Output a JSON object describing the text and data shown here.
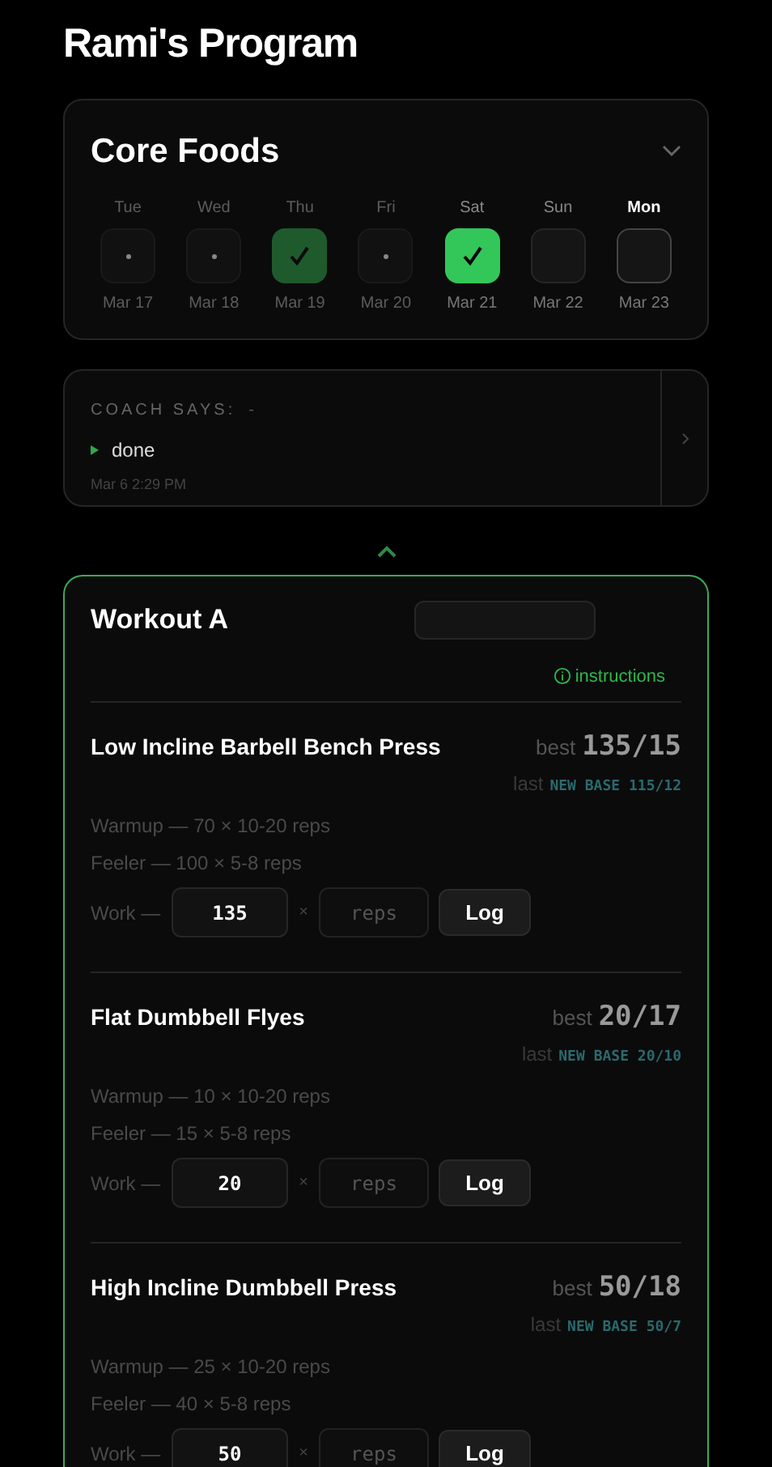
{
  "title": "Rami's Program",
  "core_foods": {
    "title": "Core Foods",
    "days": [
      {
        "kind": "past",
        "day": "Tue",
        "date": "Mar 17",
        "checked": false
      },
      {
        "kind": "past",
        "day": "Wed",
        "date": "Mar 18",
        "checked": false
      },
      {
        "kind": "past",
        "day": "Thu",
        "date": "Mar 19",
        "checked": true
      },
      {
        "kind": "past",
        "day": "Fri",
        "date": "Mar 20",
        "checked": false
      },
      {
        "kind": "upcoming",
        "day": "Sat",
        "date": "Mar 21",
        "checked": true
      },
      {
        "kind": "upcoming",
        "day": "Sun",
        "date": "Mar 22",
        "checked": false
      },
      {
        "kind": "today",
        "day": "Mon",
        "date": "Mar 23",
        "checked": false
      }
    ]
  },
  "coach": {
    "label": "COACH SAYS:",
    "separator": "-",
    "message": "done",
    "time": "Mar 6 2:29 PM"
  },
  "workout": {
    "title": "Workout A",
    "instructions": "instructions",
    "exercises": [
      {
        "name": "Low Incline Barbell Bench Press",
        "best_label": "best",
        "best": "135/15",
        "last_label": "last",
        "last": "NEW BASE 115/12",
        "warmup": "Warmup — 70 × 10-20 reps",
        "feeler": "Feeler — 100 × 5-8 reps",
        "work_label": "Work —",
        "weight": "135",
        "times": "×",
        "reps_placeholder": "reps",
        "log": "Log"
      },
      {
        "name": "Flat Dumbbell Flyes",
        "best_label": "best",
        "best": "20/17",
        "last_label": "last",
        "last": "NEW BASE 20/10",
        "warmup": "Warmup — 10 × 10-20 reps",
        "feeler": "Feeler — 15 × 5-8 reps",
        "work_label": "Work —",
        "weight": "20",
        "times": "×",
        "reps_placeholder": "reps",
        "log": "Log"
      },
      {
        "name": "High Incline Dumbbell Press",
        "best_label": "best",
        "best": "50/18",
        "last_label": "last",
        "last": "NEW BASE 50/7",
        "warmup": "Warmup — 25 × 10-20 reps",
        "feeler": "Feeler — 40 × 5-8 reps",
        "work_label": "Work —",
        "weight": "50",
        "times": "×",
        "reps_placeholder": "reps",
        "log": "Log"
      }
    ]
  }
}
